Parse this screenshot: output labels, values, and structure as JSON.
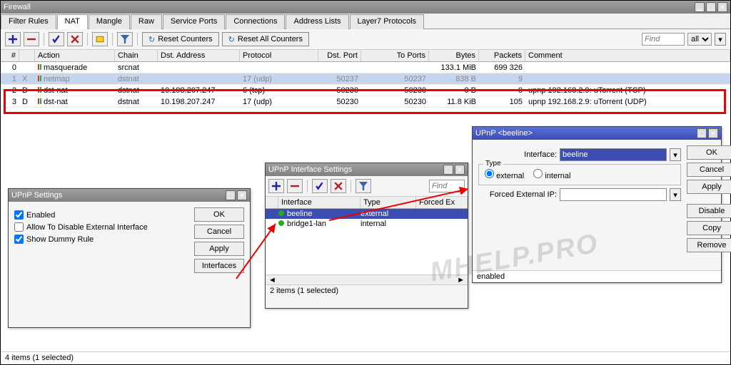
{
  "window": {
    "title": "Firewall"
  },
  "tabs": [
    "Filter Rules",
    "NAT",
    "Mangle",
    "Raw",
    "Service Ports",
    "Connections",
    "Address Lists",
    "Layer7 Protocols"
  ],
  "active_tab": "NAT",
  "toolbar": {
    "reset_counters": "Reset Counters",
    "reset_all": "Reset All Counters",
    "find_ph": "Find",
    "filter_all": "all"
  },
  "grid": {
    "cols": [
      "#",
      "",
      "Action",
      "Chain",
      "Dst. Address",
      "Protocol",
      "Dst. Port",
      "To Ports",
      "Bytes",
      "Packets",
      "Comment"
    ],
    "rows": [
      {
        "n": "0",
        "flag": "",
        "act": "masquerade",
        "chain": "srcnat",
        "dst": "",
        "proto": "",
        "dport": "",
        "tport": "",
        "bytes": "133.1 MiB",
        "pkts": "699 326",
        "cmt": ""
      },
      {
        "n": "1",
        "flag": "X",
        "act": "netmap",
        "chain": "dstnat",
        "dst": "",
        "proto": "17 (udp)",
        "dport": "50237",
        "tport": "50237",
        "bytes": "838 B",
        "pkts": "9",
        "cmt": "",
        "sel": true,
        "dis": true
      },
      {
        "n": "2",
        "flag": "D",
        "act": "dst-nat",
        "chain": "dstnat",
        "dst": "10.198.207.247",
        "proto": "6 (tcp)",
        "dport": "50230",
        "tport": "50230",
        "bytes": "0 B",
        "pkts": "0",
        "cmt": "upnp 192.168.2.9: uTorrent (TCP)"
      },
      {
        "n": "3",
        "flag": "D",
        "act": "dst-nat",
        "chain": "dstnat",
        "dst": "10.198.207.247",
        "proto": "17 (udp)",
        "dport": "50230",
        "tport": "50230",
        "bytes": "11.8 KiB",
        "pkts": "105",
        "cmt": "upnp 192.168.2.9: uTorrent (UDP)"
      }
    ]
  },
  "status": "4 items (1 selected)",
  "upnp_settings": {
    "title": "UPnP Settings",
    "enabled": "Enabled",
    "allow_disable": "Allow To Disable External Interface",
    "show_dummy": "Show Dummy Rule",
    "ok": "OK",
    "cancel": "Cancel",
    "apply": "Apply",
    "interfaces": "Interfaces"
  },
  "iface_win": {
    "title": "UPnP Interface Settings",
    "find_ph": "Find",
    "cols": [
      "",
      "Interface",
      "Type",
      "Forced Ex"
    ],
    "rows": [
      {
        "name": "beeline",
        "type": "external",
        "sel": true
      },
      {
        "name": "bridge1-lan",
        "type": "internal"
      }
    ],
    "status": "2 items (1 selected)"
  },
  "beeline_win": {
    "title": "UPnP <beeline>",
    "interface_lbl": "Interface:",
    "interface_val": "beeline",
    "type_legend": "Type",
    "external": "external",
    "internal": "internal",
    "forced_lbl": "Forced External IP:",
    "ok": "OK",
    "cancel": "Cancel",
    "apply": "Apply",
    "disable": "Disable",
    "copy": "Copy",
    "remove": "Remove",
    "status": "enabled"
  },
  "watermark": "MHELP.PRO"
}
